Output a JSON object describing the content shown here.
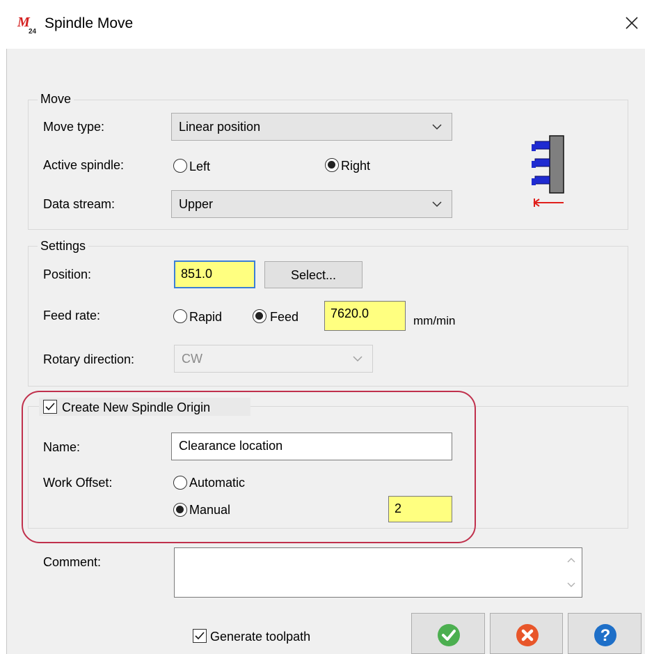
{
  "window": {
    "title": "Spindle Move",
    "app_icon_text": "M24"
  },
  "move_group": {
    "legend": "Move",
    "move_type_label": "Move type:",
    "move_type_value": "Linear position",
    "active_spindle_label": "Active spindle:",
    "spindle_left": "Left",
    "spindle_right": "Right",
    "spindle_selected": "Right",
    "data_stream_label": "Data stream:",
    "data_stream_value": "Upper"
  },
  "settings_group": {
    "legend": "Settings",
    "position_label": "Position:",
    "position_value": "851.0",
    "select_button": "Select...",
    "feed_rate_label": "Feed rate:",
    "rapid_label": "Rapid",
    "feed_label": "Feed",
    "feed_selected": "Feed",
    "feed_value": "7620.0",
    "feed_unit": "mm/min",
    "rotary_label": "Rotary direction:",
    "rotary_value": "CW",
    "rotary_disabled": true
  },
  "origin_group": {
    "checkbox_label": "Create New Spindle Origin",
    "checked": true,
    "name_label": "Name:",
    "name_value": "Clearance location",
    "work_offset_label": "Work Offset:",
    "automatic_label": "Automatic",
    "manual_label": "Manual",
    "offset_selected": "Manual",
    "manual_value": "2"
  },
  "comment": {
    "label": "Comment:",
    "value": ""
  },
  "footer": {
    "generate_toolpath_label": "Generate toolpath",
    "generate_checked": true,
    "ok_icon": "checkmark-icon",
    "cancel_icon": "cancel-x-icon",
    "help_icon": "help-question-icon"
  },
  "colors": {
    "input_highlight": "#ffff80",
    "annotation_outline": "#c0304c",
    "ok_green": "#4caf50",
    "cancel_orange": "#e8562a",
    "help_blue": "#1e6fc8",
    "spindle_blue": "#1f2bd1",
    "arrow_red": "#e0201c"
  }
}
